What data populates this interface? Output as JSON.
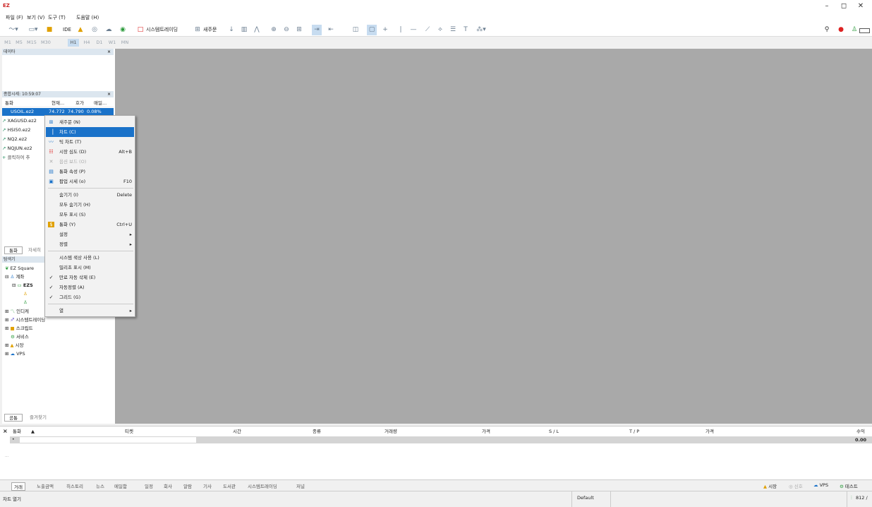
{
  "app": {
    "title_icon": "EZ"
  },
  "window": {
    "min": "–",
    "max": "◻",
    "close": "✕"
  },
  "menu": [
    "파일 (F)",
    "보기 (V)",
    "도구 (T)",
    "도움말 (H)"
  ],
  "toolbar": {
    "ide": "IDE",
    "systrading": "시스템트레이딩",
    "neworder": "새주문"
  },
  "timeframes": [
    "M1",
    "M5",
    "M15",
    "M30",
    "H1",
    "H4",
    "D1",
    "W1",
    "MN"
  ],
  "data_panel": {
    "title": "데이타"
  },
  "quotes_panel": {
    "title": "종합시세: 10:59:07",
    "headers": [
      "통화",
      "현재...",
      "호가",
      "매일..."
    ],
    "rows": [
      {
        "symbol": "USOIL.ez2",
        "bid": "74.772",
        "ask": "74.790",
        "change": "0.08%"
      },
      {
        "symbol": "XAGUSD.ez2"
      },
      {
        "symbol": "HSI50.ez2"
      },
      {
        "symbol": "NQ2.ez2"
      },
      {
        "symbol": "NQJUN.ez2"
      }
    ],
    "add_row": "클릭하여 추",
    "tabs": [
      "통화",
      "자세히"
    ]
  },
  "navigator": {
    "title": "탐색기",
    "items": [
      "EZ Square",
      "계좌",
      "EZS",
      "인디케",
      "시스템트레이딩",
      "스크립트",
      "서비스",
      "시장",
      "VPS"
    ],
    "tabs": [
      "공통",
      "즐겨찾기"
    ]
  },
  "context_menu": {
    "items": [
      {
        "label": "새주문 (N)",
        "shortcut": "",
        "icon": "new-order-icon"
      },
      {
        "label": "차트 (C)",
        "shortcut": "",
        "icon": "chart-icon"
      },
      {
        "label": "틱 차트 (T)",
        "shortcut": "",
        "icon": "tick-chart-icon"
      },
      {
        "label": "시장 심도 (D)",
        "shortcut": "Alt+B",
        "icon": "depth-icon"
      },
      {
        "label": "옵션 보드 (O)",
        "shortcut": "",
        "icon": "options-icon"
      },
      {
        "label": "통화 속성 (P)",
        "shortcut": "",
        "icon": "properties-icon"
      },
      {
        "label": "팝업 시세 (o)",
        "shortcut": "F10",
        "icon": "popup-icon"
      },
      {
        "label": "숨기기 (I)",
        "shortcut": "Delete"
      },
      {
        "label": "모두 숨기기 (H)",
        "shortcut": ""
      },
      {
        "label": "모두 표시 (S)",
        "shortcut": ""
      },
      {
        "label": "통화 (Y)",
        "shortcut": "Ctrl+U",
        "icon": "symbols-icon"
      },
      {
        "label": "설정",
        "shortcut": "▸"
      },
      {
        "label": "정렬",
        "shortcut": "▸"
      },
      {
        "label": "시스템 색상 사용 (L)",
        "shortcut": ""
      },
      {
        "label": "밀리초 표시 (M)",
        "shortcut": ""
      },
      {
        "label": "만료 자동 삭제 (E)",
        "shortcut": "",
        "check": "✓"
      },
      {
        "label": "자동정렬 (A)",
        "shortcut": "",
        "check": "✓"
      },
      {
        "label": "그리드 (G)",
        "shortcut": "",
        "check": "✓"
      },
      {
        "label": "열",
        "shortcut": "▸"
      }
    ]
  },
  "trade_table": {
    "headers": [
      "통화",
      "티켓",
      "시간",
      "종류",
      "거래량",
      "가격",
      "S / L",
      "T / P",
      "가격",
      "수익"
    ],
    "profit": "0.00"
  },
  "bottom_tabs": [
    "거래",
    "노출금액",
    "히스토리",
    "뉴스",
    "메일함",
    "일정",
    "회사",
    "알람",
    "기사",
    "도서관",
    "시스템트레이딩",
    "저널"
  ],
  "bottom_right": [
    "시장",
    "신호",
    "VPS",
    "테스트"
  ],
  "status": {
    "left": "차트 열기",
    "profile": "Default",
    "conn": "812 /"
  },
  "colors": {
    "accent": "#1a72c9",
    "chart_bg": "#a9a9a9"
  }
}
